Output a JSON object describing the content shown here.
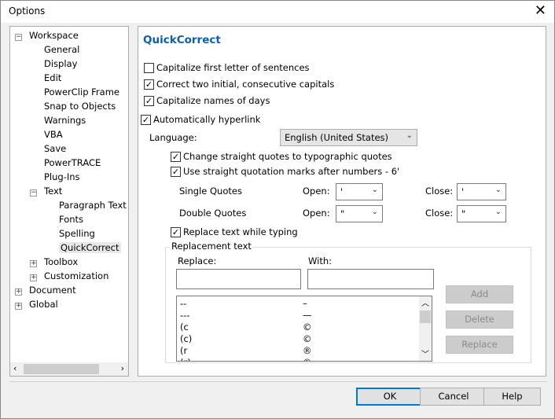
{
  "window": {
    "title": "Options"
  },
  "tree": {
    "items": [
      {
        "label": "Workspace",
        "level": 0,
        "toggle": "minus"
      },
      {
        "label": "General",
        "level": 1
      },
      {
        "label": "Display",
        "level": 1
      },
      {
        "label": "Edit",
        "level": 1
      },
      {
        "label": "PowerClip Frame",
        "level": 1
      },
      {
        "label": "Snap to Objects",
        "level": 1
      },
      {
        "label": "Warnings",
        "level": 1
      },
      {
        "label": "VBA",
        "level": 1
      },
      {
        "label": "Save",
        "level": 1
      },
      {
        "label": "PowerTRACE",
        "level": 1
      },
      {
        "label": "Plug-Ins",
        "level": 1
      },
      {
        "label": "Text",
        "level": 1,
        "toggle": "minus"
      },
      {
        "label": "Paragraph Text F",
        "level": 2
      },
      {
        "label": "Fonts",
        "level": 2
      },
      {
        "label": "Spelling",
        "level": 2
      },
      {
        "label": "QuickCorrect",
        "level": 2,
        "selected": true
      },
      {
        "label": "Toolbox",
        "level": 1,
        "toggle": "plus"
      },
      {
        "label": "Customization",
        "level": 1,
        "toggle": "plus"
      },
      {
        "label": "Document",
        "level": 0,
        "toggle": "plus"
      },
      {
        "label": "Global",
        "level": 0,
        "toggle": "plus"
      }
    ]
  },
  "panel": {
    "title": "QuickCorrect",
    "capitalize_first": {
      "label": "Capitalize first letter of sentences",
      "checked": false
    },
    "two_capitals": {
      "label": "Correct two initial, consecutive capitals",
      "checked": true
    },
    "days": {
      "label": "Capitalize names of days",
      "checked": true
    },
    "hyperlink": {
      "label": "Automatically hyperlink",
      "checked": true
    },
    "language_label": "Language:",
    "language_value": "English (United States)",
    "typographic": {
      "label": "Change straight quotes to typographic quotes",
      "checked": true
    },
    "straight_numbers": {
      "label": "Use straight quotation marks after numbers - 6'",
      "checked": true
    },
    "single_quotes": "Single Quotes",
    "double_quotes": "Double Quotes",
    "open_label": "Open:",
    "close_label": "Close:",
    "single_open": "'",
    "single_close": "'",
    "double_open": "\"",
    "double_close": "\"",
    "replace_typing": {
      "label": "Replace text while typing",
      "checked": true
    },
    "group_label": "Replacement text",
    "replace_label": "Replace:",
    "with_label": "With:",
    "replace_value": "",
    "with_value": "",
    "rows": [
      [
        "--",
        "–"
      ],
      [
        "---",
        "—"
      ],
      [
        "(c",
        "©"
      ],
      [
        "(c)",
        "©"
      ],
      [
        "(r",
        "®"
      ],
      [
        "(r)",
        "®"
      ]
    ],
    "add": "Add",
    "delete": "Delete",
    "replace": "Replace"
  },
  "footer": {
    "ok": "OK",
    "cancel": "Cancel",
    "help": "Help"
  }
}
